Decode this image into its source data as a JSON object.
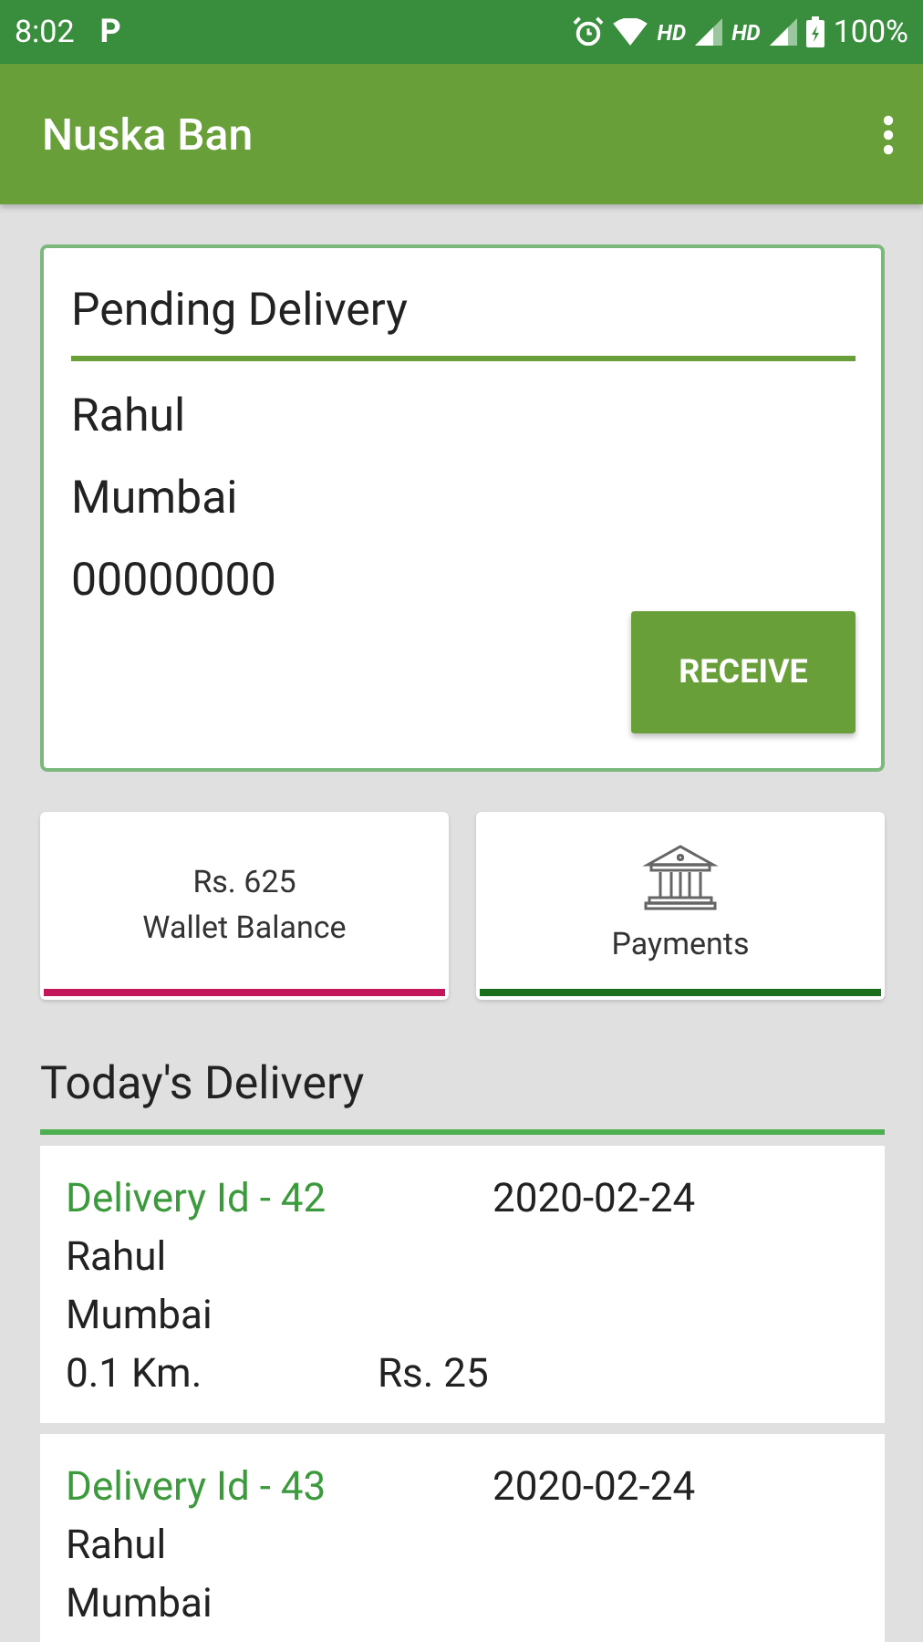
{
  "status_bar": {
    "time": "8:02",
    "notification": "P",
    "network_labels": [
      "HD",
      "HD"
    ],
    "battery": "100%"
  },
  "app_bar": {
    "title": "Nuska Ban"
  },
  "pending": {
    "title": "Pending Delivery",
    "lines": [
      "Rahul",
      "Mumbai",
      "00000000"
    ],
    "button": "RECEIVE"
  },
  "stats": [
    {
      "kind": "amount",
      "value": "Rs. 625",
      "label": "Wallet Balance",
      "color": "#c2185b"
    },
    {
      "kind": "icon",
      "label": "Payments",
      "color": "#1b6e1b"
    }
  ],
  "today": {
    "title": "Today's Delivery",
    "items": [
      {
        "id": "Delivery Id - 42",
        "date": "2020-02-24",
        "name": "Rahul",
        "city": "Mumbai",
        "distance": "0.1 Km.",
        "amount": "Rs. 25"
      },
      {
        "id": "Delivery Id - 43",
        "date": "2020-02-24",
        "name": "Rahul",
        "city": "Mumbai"
      }
    ]
  }
}
